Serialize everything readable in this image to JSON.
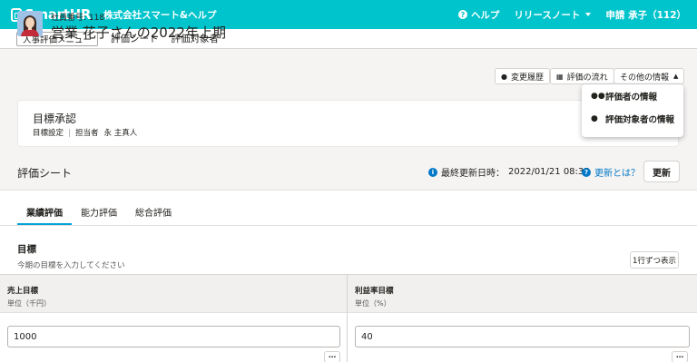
{
  "header": {
    "logo_text": "SmartHR",
    "company": "株式会社スマート&ヘルプ",
    "help": "ヘルプ",
    "release_notes": "リリースノート",
    "user": "申請 承子（112）"
  },
  "subnav": {
    "menu_button": "人事評価メニュー",
    "links": [
      "評価シート",
      "評価対象者"
    ]
  },
  "employee": {
    "number_label": "社員番号: 118",
    "title": "営業 花子さんの2022年上期",
    "actions": {
      "history": "変更履歴",
      "flow": "評価の流れ",
      "other": "その他の情報"
    }
  },
  "dropdown": {
    "items": [
      "評価者の情報",
      "評価対象者の情報"
    ]
  },
  "goal_card": {
    "title": "目標承認",
    "stage": "目標設定",
    "owner_label": "担当者",
    "owner": "永 主真人"
  },
  "sheet": {
    "title": "評価シート",
    "last_updated_label": "最終更新日時：",
    "last_updated": "2022/01/21 08:35",
    "what_link": "更新とは？",
    "refresh_button": "更新"
  },
  "tabs": [
    "業績評価",
    "能力評価",
    "総合評価"
  ],
  "section": {
    "title": "目標",
    "subtitle": "今期の目標を入力してください",
    "row_button": "1行ずつ表示"
  },
  "columns": [
    {
      "title": "売上目標",
      "unit": "単位（千円）",
      "value": "1000"
    },
    {
      "title": "利益率目標",
      "unit": "単位（%）",
      "value": "40"
    }
  ],
  "colors": {
    "brand": "#00c4cc",
    "link": "#0077c7",
    "tab_active": "#00a3d9"
  }
}
